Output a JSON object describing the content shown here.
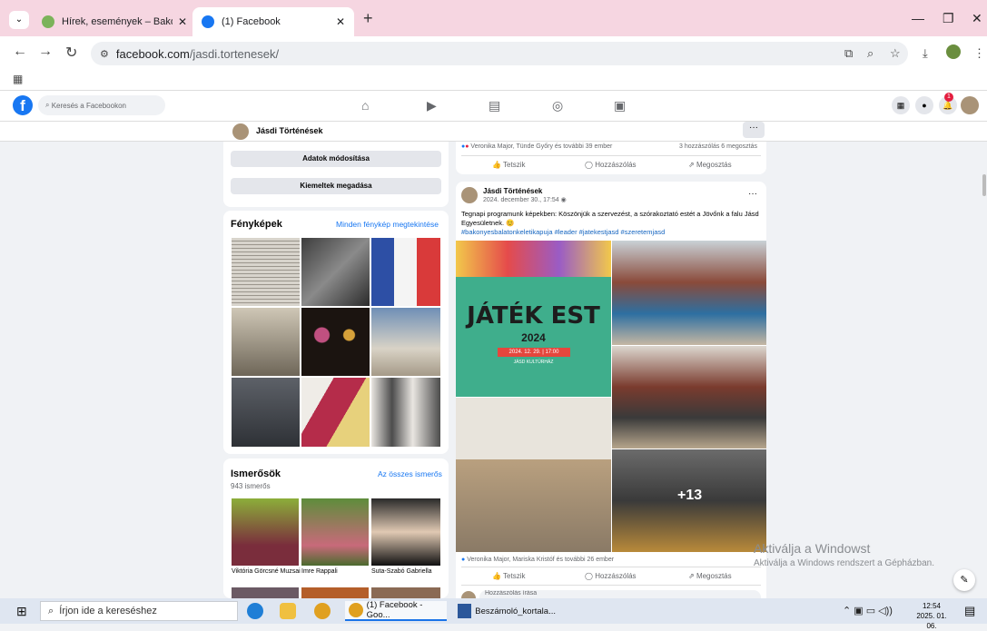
{
  "browser": {
    "tabs": [
      {
        "title": "Hírek, események – Bakony és B",
        "active": false
      },
      {
        "title": "(1) Facebook",
        "active": true
      }
    ],
    "url_domain": "facebook.com",
    "url_path": "/jasdi.tortenesek/",
    "colors": {
      "tabstrip": "#f6d6e1"
    }
  },
  "facebook": {
    "search_placeholder": "Keresés a Facebookon",
    "notification_count": "1"
  },
  "page": {
    "name": "Jásdi Történések",
    "buttons": {
      "edit": "Adatok módosítása",
      "highlight": "Kiemeltek megadása"
    }
  },
  "photos": {
    "title": "Fényképek",
    "see_all": "Minden fénykép megtekintése"
  },
  "friends": {
    "title": "Ismerősök",
    "see_all": "Az összes ismerős",
    "count": "943 ismerős",
    "list": [
      {
        "name": "Viktória Görcsné Muzsai"
      },
      {
        "name": "Imre Rappali"
      },
      {
        "name": "Suta-Szabó Gabriella"
      }
    ]
  },
  "prev_post": {
    "reactions": "Veronika Major, Tünde Győry és további 39 ember",
    "stats": "3 hozzászólás  6 megosztás"
  },
  "actions": {
    "like": "Tetszik",
    "comment": "Hozzászólás",
    "share": "Megosztás"
  },
  "post": {
    "author": "Jásdi Történések",
    "date": "2024. december 30., 17:54",
    "text": "Tegnapi programunk képekben: Köszönjük a szervezést,  a szórakoztató estét a Jövőnk a falu Jásd Egyesületnek. 😊",
    "hashtags": "#bakonyesbalatonkeletikapuja #leader #jatekestjasd #szeretemjasd",
    "poster_title": "JÁTÉK EST",
    "poster_year": "2024",
    "poster_date": "2024. 12. 29. | 17:00",
    "poster_venue": "JÁSD KULTÚRHÁZ",
    "more_photos": "+13",
    "reactions": "Veronika Major, Mariska Kristóf és további 26 ember",
    "comment_placeholder": "Hozzászólás írása"
  },
  "windows": {
    "watermark_title": "Aktiválja a Windowst",
    "watermark_sub": "Aktiválja a Windows rendszert a Gépházban.",
    "search_placeholder": "Írjon ide a kereséshez",
    "apps": [
      {
        "label": "(1) Facebook - Goo..."
      },
      {
        "label": "Beszámoló_kortala..."
      }
    ],
    "time": "12:54",
    "date": "2025. 01. 06."
  }
}
